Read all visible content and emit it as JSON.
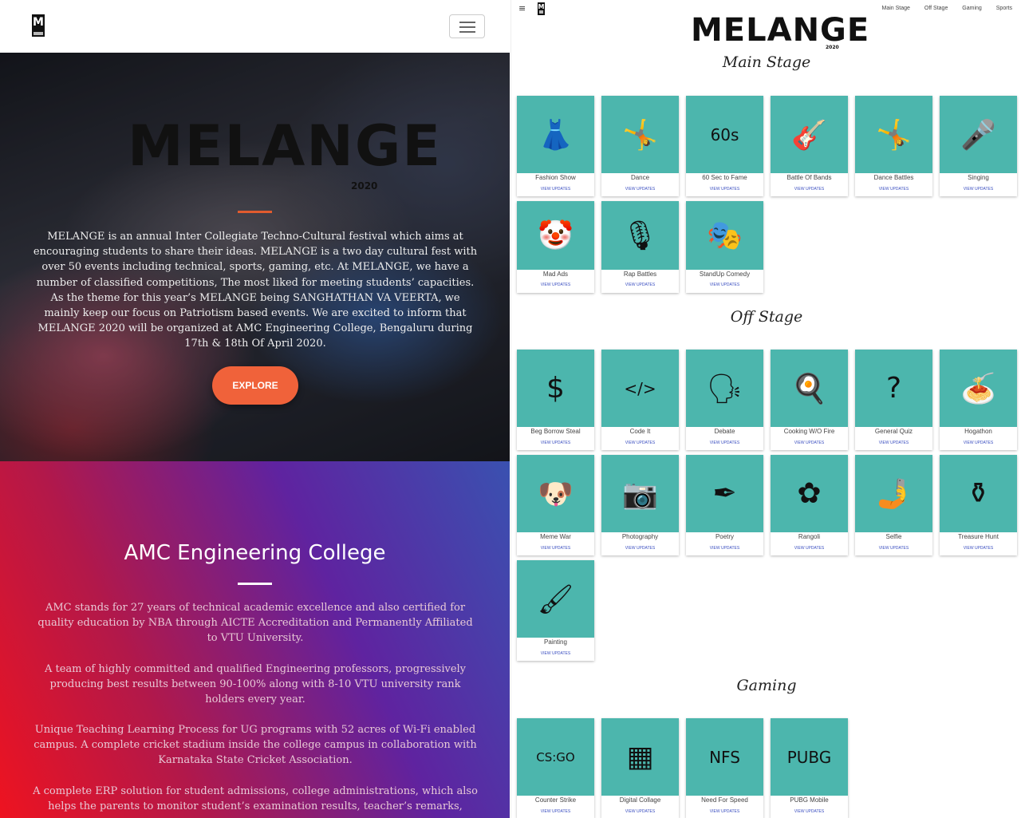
{
  "left": {
    "hero": {
      "logo": "MELANGE",
      "year": "2020",
      "description": "MELANGE is an annual Inter Collegiate Techno-Cultural festival which aims at encouraging students to share their ideas. MELANGE is a two day cultural fest with over 50 events including technical, sports, gaming, etc. At MELANGE, we have a number of classified competitions, The most liked for meeting students’ capacities. As the theme for this year’s MELANGE being SANGHATHAN VA VEERTA, we mainly keep our focus on Patriotism based events. We are excited to inform that MELANGE 2020 will be organized at AMC Engineering College, Bengaluru during 17th & 18th Of April 2020.",
      "explore_label": "EXPLORE"
    },
    "college": {
      "title": "AMC Engineering College",
      "paragraphs": [
        "AMC stands for 27 years of technical academic excellence and also certified for quality education by NBA through AICTE Accreditation and Permanently Affiliated to VTU University.",
        "A team of highly committed and qualified Engineering professors, progressively producing best results between 90-100% along with 8-10 VTU university rank holders every year.",
        "Unique Teaching Learning Process for UG programs with 52 acres of Wi-Fi enabled campus. A complete cricket stadium inside the college campus in collaboration with Karnataka State Cricket Association.",
        "A complete ERP solution for student admissions, college administrations, which also helps the parents to monitor student’s examination results, teacher’s remarks,"
      ]
    }
  },
  "right": {
    "nav": {
      "menu_icon": "≡",
      "links": [
        "Main Stage",
        "Off Stage",
        "Gaming",
        "Sports"
      ]
    },
    "brand": "MELANGE",
    "brand_year": "2020",
    "update_label": "VIEW UPDATES",
    "sections": [
      {
        "title": "Main Stage",
        "events": [
          {
            "name": "Fashion Show",
            "icon": "fashion-dress-icon",
            "glyph": "👗"
          },
          {
            "name": "Dance",
            "icon": "breakdance-icon",
            "glyph": "🤸"
          },
          {
            "name": "60 Sec to Fame",
            "icon": "60s-timer-icon",
            "glyph": "60s"
          },
          {
            "name": "Battle Of Bands",
            "icon": "band-icon",
            "glyph": "🎸"
          },
          {
            "name": "Dance Battles",
            "icon": "breakdance-icon",
            "glyph": "🤸"
          },
          {
            "name": "Singing",
            "icon": "microphone-icon",
            "glyph": "🎤"
          },
          {
            "name": "Mad Ads",
            "icon": "clown-icon",
            "glyph": "🤡"
          },
          {
            "name": "Rap Battles",
            "icon": "rapper-icon",
            "glyph": "🎙"
          },
          {
            "name": "StandUp Comedy",
            "icon": "theatre-masks-icon",
            "glyph": "🎭"
          }
        ]
      },
      {
        "title": "Off Stage",
        "events": [
          {
            "name": "Beg Borrow Steal",
            "icon": "money-hand-icon",
            "glyph": "$"
          },
          {
            "name": "Code It",
            "icon": "code-icon",
            "glyph": "</>"
          },
          {
            "name": "Debate",
            "icon": "podium-icon",
            "glyph": "🗣"
          },
          {
            "name": "Cooking W/O Fire",
            "icon": "cooking-icon",
            "glyph": "🍳"
          },
          {
            "name": "General Quiz",
            "icon": "question-bubble-icon",
            "glyph": "?"
          },
          {
            "name": "Hogathon",
            "icon": "eating-icon",
            "glyph": "🍝"
          },
          {
            "name": "Meme War",
            "icon": "doge-icon",
            "glyph": "🐶"
          },
          {
            "name": "Photography",
            "icon": "camera-icon",
            "glyph": "📷"
          },
          {
            "name": "Poetry",
            "icon": "pen-icon",
            "glyph": "✒"
          },
          {
            "name": "Rangoli",
            "icon": "mandala-icon",
            "glyph": "✿"
          },
          {
            "name": "Selfie",
            "icon": "selfie-icon",
            "glyph": "🤳"
          },
          {
            "name": "Treasure Hunt",
            "icon": "treasure-chest-icon",
            "glyph": "⚱"
          },
          {
            "name": "Painting",
            "icon": "paintbrush-icon",
            "glyph": "🖌"
          }
        ]
      },
      {
        "title": "Gaming",
        "events": [
          {
            "name": "Counter Strike",
            "icon": "csgo-logo-icon",
            "glyph": "CS:GO"
          },
          {
            "name": "Digital Collage",
            "icon": "collage-icon",
            "glyph": "▦"
          },
          {
            "name": "Need For Speed",
            "icon": "nfs-logo-icon",
            "glyph": "NFS"
          },
          {
            "name": "PUBG Mobile",
            "icon": "pubg-logo-icon",
            "glyph": "PUBG"
          }
        ]
      }
    ]
  }
}
